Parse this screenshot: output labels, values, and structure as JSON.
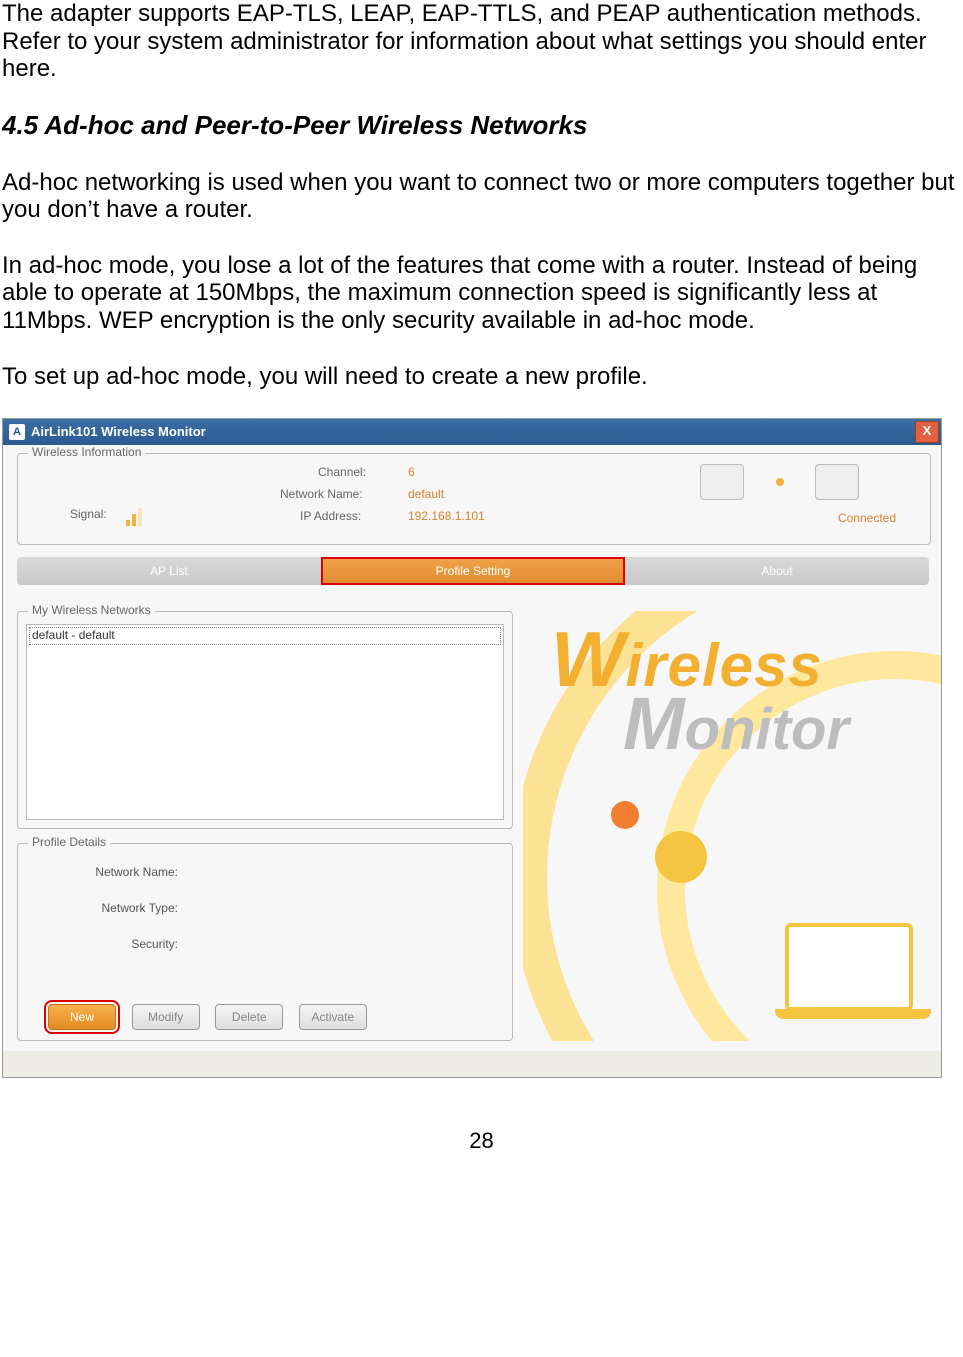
{
  "doc": {
    "intro": "The adapter supports EAP-TLS, LEAP, EAP-TTLS, and PEAP authentication methods. Refer to your system administrator for information about what settings you should enter here.",
    "heading": "4.5 Ad-hoc and Peer-to-Peer Wireless Networks",
    "p1": "Ad-hoc networking is used when you want to connect two or more computers together but you don’t have a router.",
    "p2": "In ad-hoc mode, you lose a lot of the features that come with a router.  Instead of being able to operate at 150Mbps, the maximum connection speed is significantly less at 11Mbps.  WEP encryption is the only security available in ad-hoc mode.",
    "p3": "To set up ad-hoc mode, you will need to create a new profile.",
    "page_number": "28"
  },
  "app": {
    "title": "AirLink101 Wireless Monitor",
    "icon_glyph": "A",
    "close_glyph": "X",
    "info": {
      "legend": "Wireless Information",
      "signal_label": "Signal:",
      "channel_label": "Channel:",
      "channel_value": "6",
      "netname_label": "Network Name:",
      "netname_value": "default",
      "ip_label": "IP Address:",
      "ip_value": "192.168.1.101",
      "status": "Connected"
    },
    "tabs": {
      "ap_list": "AP List",
      "profile_setting": "Profile Setting",
      "about": "About"
    },
    "mynets": {
      "legend": "My Wireless Networks",
      "item0": "default - default"
    },
    "details": {
      "legend": "Profile Details",
      "netname": "Network Name:",
      "nettype": "Network Type:",
      "security": "Security:"
    },
    "buttons": {
      "new": "New",
      "modify": "Modify",
      "delete": "Delete",
      "activate": "Activate"
    },
    "deco": {
      "word1_cap": "W",
      "word1_rest": "ireless",
      "word2_cap": "M",
      "word2_rest": "onitor"
    }
  }
}
